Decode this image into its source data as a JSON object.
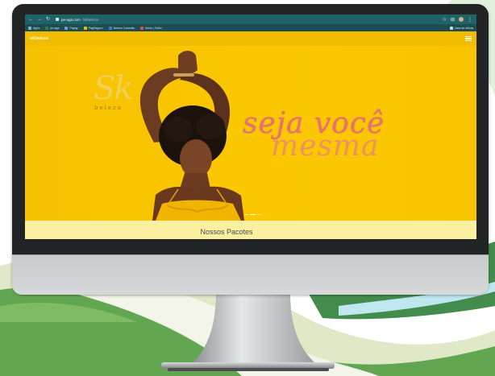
{
  "browser": {
    "url_host": "pe-aga.com",
    "url_path": "/skbeleza",
    "bookmarks": [
      "Apps",
      "pe-aga",
      "Papay",
      "PagSeguro",
      "Nelson Conexão",
      "Início | Twilio"
    ],
    "bookmarks_right": "Lista de leitura"
  },
  "site": {
    "brand": "skbeleza",
    "logo_main": "Sk",
    "logo_sub": "beleza",
    "slogan_line1": "seja você",
    "slogan_line2": "mesma",
    "section_title": "Nossos Pacotes",
    "carousel": {
      "slides": 3,
      "active_index": 1
    }
  },
  "colors": {
    "hero_yellow": "#f6c100",
    "tab_bar": "#1f6268",
    "slogan_pink": "#e87272",
    "section_bg": "#fbf0a0",
    "swoosh_green": "#3a9a3f"
  },
  "icons": [
    "back-arrow-icon",
    "forward-arrow-icon",
    "reload-icon",
    "lock-icon",
    "star-icon",
    "extension-icon",
    "menu-dots-icon",
    "hamburger-menu-icon"
  ]
}
